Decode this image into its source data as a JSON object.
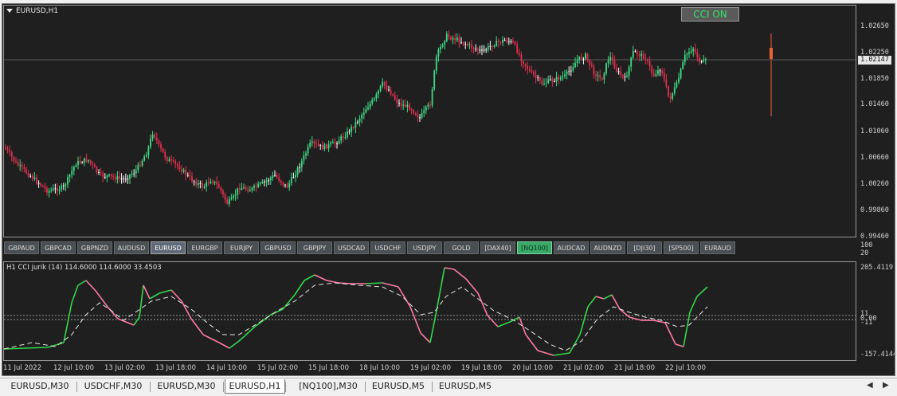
{
  "chart": {
    "title": "EURUSD,H1",
    "cci_button": "CCI ON",
    "price_labels": [
      "1.02650",
      "1.02250",
      "1.01850",
      "1.01460",
      "1.01060",
      "1.00660",
      "1.00260",
      "0.99860",
      "0.99460"
    ],
    "current_price": "1.02147",
    "colors": {
      "bull": "#3ddc84",
      "bear": "#e0304e",
      "neutral": "#ffffff",
      "cci_up": "#32d74b",
      "cci_down": "#ff7aa2"
    }
  },
  "symbol_buttons": [
    "GBPAUD",
    "GBPCAD",
    "GBPNZD",
    "AUDUSD",
    "EURUSD",
    "EURGBP",
    "EURJPY",
    "GBPUSD",
    "GBPJPY",
    "USDCAD",
    "USDCHF",
    "USDJPY",
    "GOLD",
    "[DAX40]",
    "[NQ100]",
    "AUDCAD",
    "AUDNZD",
    "[DJI30]",
    "[SP500]",
    "EURAUD"
  ],
  "active_symbol": "EURUSD",
  "highlight_symbol": "[NQ100]",
  "indicator": {
    "title": "H1  CCI jurik (14) 114.6000 114.6000 33.4503",
    "side_labels": [
      "100",
      "20"
    ],
    "axis_labels": [
      "205.4119",
      "11",
      "0.00",
      "-11",
      "-157.4144"
    ]
  },
  "time_labels": [
    "11 Jul 2022",
    "12 Jul 10:00",
    "13 Jul 02:00",
    "13 Jul 18:00",
    "14 Jul 10:00",
    "15 Jul 02:00",
    "15 Jul 18:00",
    "18 Jul 10:00",
    "19 Jul 02:00",
    "19 Jul 18:00",
    "20 Jul 10:00",
    "21 Jul 02:00",
    "21 Jul 18:00",
    "22 Jul 10:00"
  ],
  "tabs": [
    "EURUSD,M30",
    "USDCHF,M30",
    "EURUSD,M30",
    "EURUSD,H1",
    "[NQ100],M30",
    "EURUSD,M5",
    "EURUSD,M5"
  ],
  "active_tab": "EURUSD,H1"
}
